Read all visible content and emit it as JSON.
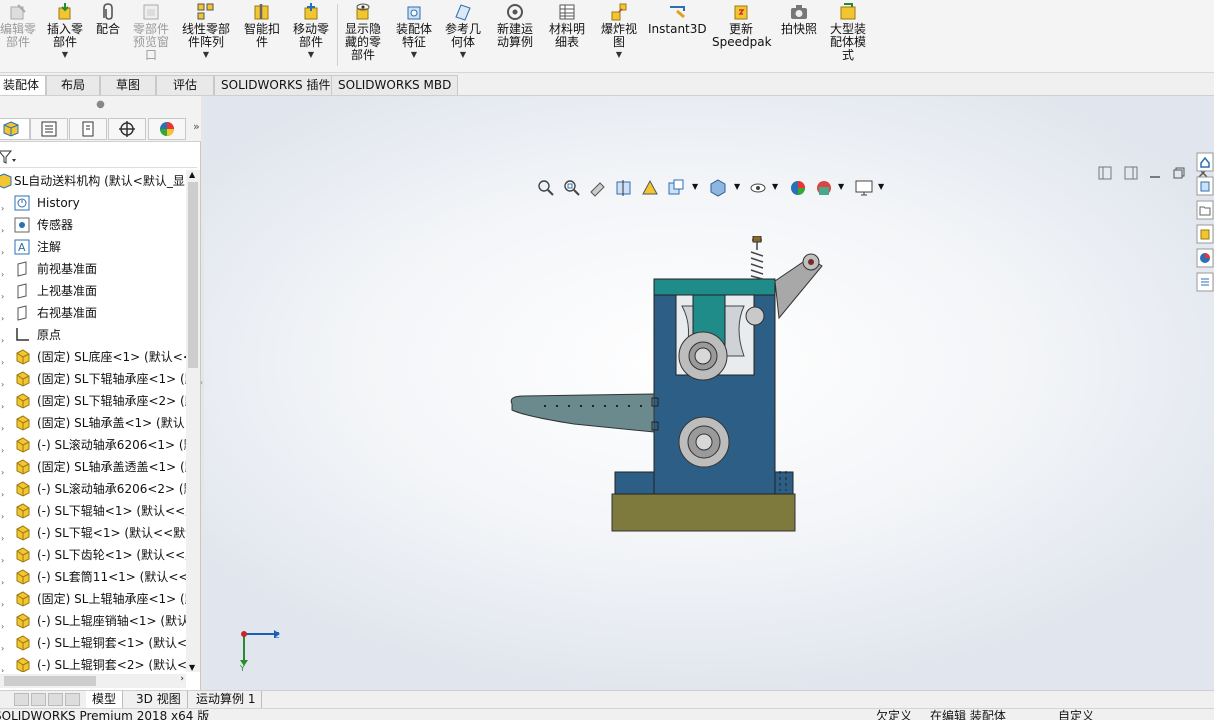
{
  "ribbon": {
    "edit_part": "编辑零\n部件",
    "insert_part": "插入零\n部件",
    "mate": "配合",
    "component_preview": "零部件\n预览窗\n口",
    "linear_pattern": "线性零部\n件阵列",
    "smart_fasteners": "智能扣\n件",
    "move_component": "移动零\n部件",
    "show_hidden": "显示隐\n藏的零\n部件",
    "assembly_features": "装配体\n特征",
    "reference_geometry": "参考几\n何体",
    "new_motion_study": "新建运\n动算例",
    "bom": "材料明\n细表",
    "exploded_view": "爆炸视\n图",
    "instant3d": "Instant3D",
    "update_speedpak": "更新\nSpeedpak",
    "snapshot": "拍快照",
    "large_assembly": "大型装\n配体模\n式"
  },
  "tabs": [
    "装配体",
    "布局",
    "草图",
    "评估",
    "SOLIDWORKS 插件",
    "SOLIDWORKS MBD"
  ],
  "tree": {
    "root": "SL自动送料机构  (默认<默认_显",
    "items": [
      "History",
      "传感器",
      "注解",
      "前视基准面",
      "上视基准面",
      "右视基准面",
      "原点",
      "(固定) SL底座<1> (默认<<",
      "(固定) SL下辊轴承座<1> (默",
      "(固定) SL下辊轴承座<2> (默",
      "(固定) SL轴承盖<1> (默认<",
      "(-) SL滚动轴承6206<1> (默",
      "(固定) SL轴承盖透盖<1> (默",
      "(-) SL滚动轴承6206<2> (默",
      "(-) SL下辊轴<1> (默认<<默",
      "(-) SL下辊<1> (默认<<默认",
      "(-) SL下齿轮<1> (默认<<默",
      "(-) SL套筒11<1> (默认<<默",
      "(固定) SL上辊轴承座<1> (默",
      "(-) SL上辊座销轴<1> (默认",
      "(-) SL上辊铜套<1> (默认<<",
      "(-) SL上辊铜套<2> (默认<<"
    ]
  },
  "triad": {
    "y": "Y",
    "z": "Z"
  },
  "bottom_tabs": [
    "模型",
    "3D 视图",
    "运动算例 1"
  ],
  "status": {
    "app": "SOLIDWORKS Premium 2018 x64 版",
    "underdefined": "欠定义",
    "editing": "在编辑 装配体",
    "custom": "自定义"
  },
  "colors": {
    "accent": "#1a5fb4",
    "model_blue": "#2d5f86",
    "model_teal": "#1f8c8a",
    "base_olive": "#7e7a3e"
  }
}
